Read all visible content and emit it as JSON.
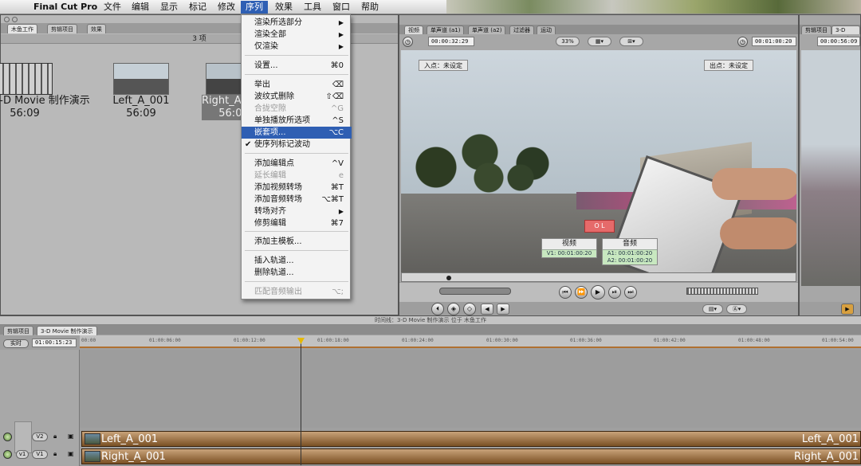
{
  "menubar": {
    "app_name": "Final Cut Pro",
    "menus": [
      "文件",
      "编辑",
      "显示",
      "标记",
      "修改",
      "序列",
      "效果",
      "工具",
      "窗口",
      "帮助"
    ]
  },
  "browser": {
    "tabs": [
      "木鱼工作",
      "剪辑项目",
      "效果"
    ],
    "item_count": "3 项",
    "clips": [
      {
        "name": "3-D Movie 制作演示",
        "duration": "56:09"
      },
      {
        "name": "Left_A_001",
        "duration": "56:09"
      },
      {
        "name": "Right_A_001",
        "duration": "56:09"
      }
    ]
  },
  "viewer": {
    "tabs": [
      "视频",
      "单声道 (a1)",
      "单声道 (a2)",
      "过滤器",
      "运动"
    ],
    "duration_tc": "00:00:32:29",
    "zoom": "33%",
    "current_tc": "00:01:00:20",
    "in_point": "入点：未设定",
    "out_point": "出点：未设定",
    "overlay_red": "O L",
    "video_panel": {
      "title": "视频",
      "v1": "V1: 00:01:00:20"
    },
    "audio_panel": {
      "title": "音频",
      "a1": "A1: 00:01:00:20",
      "a2": "A2: 00:01:00:20"
    }
  },
  "canvas": {
    "tabs": [
      "剪辑项目",
      "3-D Movie"
    ],
    "tc": "00:00:56:09"
  },
  "sequence_menu": {
    "items": [
      {
        "label": "渲染所选部分",
        "shortcut": "",
        "arrow": true,
        "disabled": false
      },
      {
        "label": "渲染全部",
        "shortcut": "",
        "arrow": true,
        "disabled": false
      },
      {
        "label": "仅渲染",
        "shortcut": "",
        "arrow": true,
        "disabled": false
      },
      {
        "label": "设置...",
        "shortcut": "⌘0",
        "disabled": false
      },
      {
        "label": "举出",
        "shortcut": "⌫",
        "disabled": false
      },
      {
        "label": "波纹式删除",
        "shortcut": "⇧⌫",
        "disabled": false
      },
      {
        "label": "合拢空隙",
        "shortcut": "^G",
        "disabled": true
      },
      {
        "label": "单独播放所选项",
        "shortcut": "^S",
        "disabled": false
      },
      {
        "label": "嵌套项...",
        "shortcut": "⌥C",
        "disabled": false,
        "highlighted": true
      },
      {
        "label": "使序列标记波动",
        "shortcut": "",
        "disabled": false,
        "checked": true
      },
      {
        "label": "添加编辑点",
        "shortcut": "^V",
        "disabled": false
      },
      {
        "label": "延长编辑",
        "shortcut": "e",
        "disabled": true
      },
      {
        "label": "添加视频转场",
        "shortcut": "⌘T",
        "disabled": false
      },
      {
        "label": "添加音频转场",
        "shortcut": "⌥⌘T",
        "disabled": false
      },
      {
        "label": "转场对齐",
        "shortcut": "",
        "arrow": true,
        "disabled": false
      },
      {
        "label": "修剪编辑",
        "shortcut": "⌘7",
        "disabled": false
      },
      {
        "label": "添加主模板...",
        "shortcut": "",
        "disabled": false
      },
      {
        "label": "插入轨道...",
        "shortcut": "",
        "disabled": false
      },
      {
        "label": "删除轨道...",
        "shortcut": "",
        "disabled": false
      },
      {
        "label": "匹配音频输出",
        "shortcut": "⌥;",
        "disabled": true
      }
    ]
  },
  "timeline": {
    "title": "时间线：3-D Movie 制作演示 位于 木鱼工作",
    "tabs": [
      "剪辑项目",
      "3-D Movie 制作演示"
    ],
    "fit_label": "实时",
    "current_tc": "01:00:15:23",
    "ruler": [
      "00:00",
      "01:00:06:00",
      "01:00:12:00",
      "01:00:18:00",
      "01:00:24:00",
      "01:00:30:00",
      "01:00:36:00",
      "01:00:42:00",
      "01:00:48:00",
      "01:00:54:00"
    ],
    "tracks": [
      {
        "label": "V2",
        "clip": "Left_A_001",
        "clip_end": "Left_A_001"
      },
      {
        "label": "V1",
        "clip": "Right_A_001",
        "clip_end": "Right_A_001"
      }
    ],
    "v1_src": "v1"
  }
}
